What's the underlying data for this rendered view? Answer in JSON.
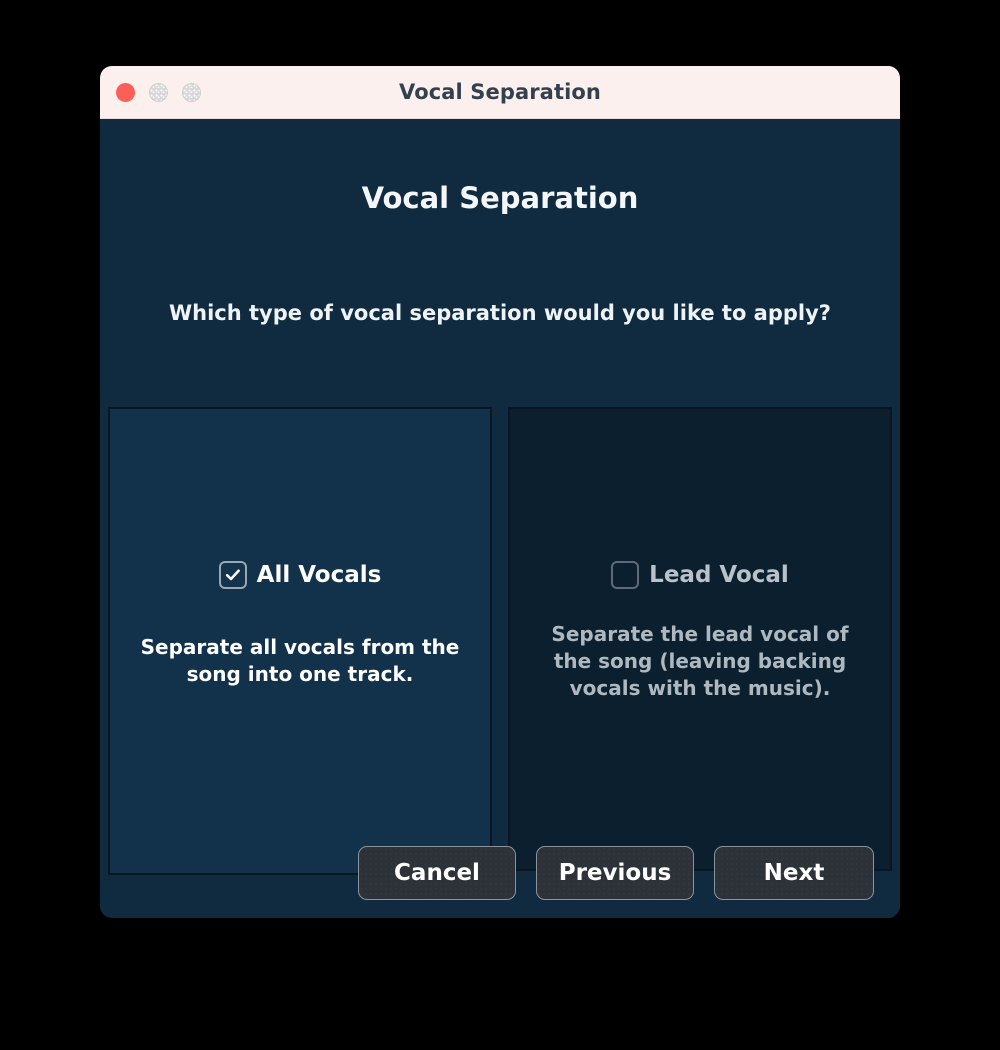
{
  "window": {
    "title": "Vocal Separation",
    "traffic_lights": [
      {
        "name": "close",
        "color": "#fc5f57"
      },
      {
        "name": "minimize",
        "color": "#d8d8d8"
      },
      {
        "name": "maximize",
        "color": "#d8d8d8"
      }
    ],
    "colors": {
      "titlebar_bg": "#fbf0ee",
      "titlebar_text": "#33404e",
      "dialog_bg": "#102b3f",
      "panel_selected_bg": "#12314a",
      "panel_unselected_bg": "#0c1f2e",
      "panel_border": "#0a1722",
      "button_bg": "#2c3237",
      "button_border": "#8a949c",
      "text_primary": "#ffffff",
      "text_dim": "#aeb8c0"
    }
  },
  "dialog": {
    "heading": "Vocal Separation",
    "question": "Which type of vocal separation would you like to apply?",
    "options": [
      {
        "label": "All Vocals",
        "description": "Separate all vocals from the song into one track.",
        "checked": true,
        "checkbox_state": "checked"
      },
      {
        "label": "Lead Vocal",
        "description": "Separate the lead vocal of the song (leaving backing vocals with the music).",
        "checked": false,
        "checkbox_state": "unchecked"
      }
    ]
  },
  "footer": {
    "cancel_label": "Cancel",
    "previous_label": "Previous",
    "next_label": "Next"
  }
}
